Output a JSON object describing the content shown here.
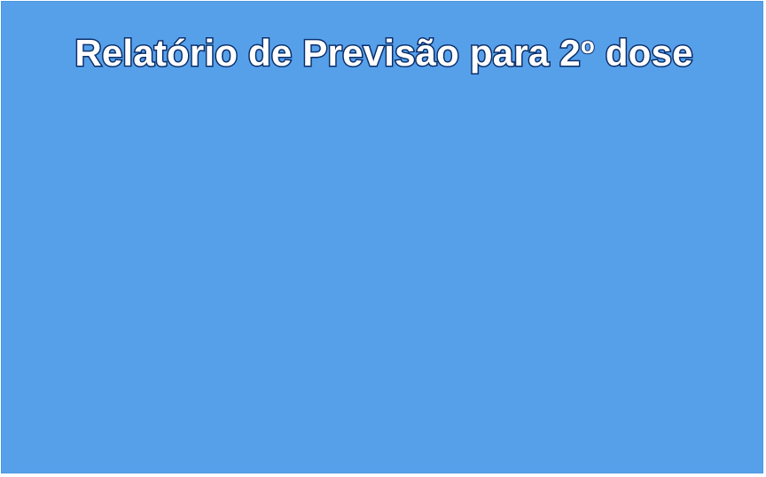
{
  "report": {
    "title_main": "Relatório de Previsão para 2",
    "title_sup": "o",
    "title_end": " dose"
  },
  "colors": {
    "panel_background": "#56a0ea",
    "title_text": "#ffffff",
    "title_outline": "#0b2f6b"
  }
}
